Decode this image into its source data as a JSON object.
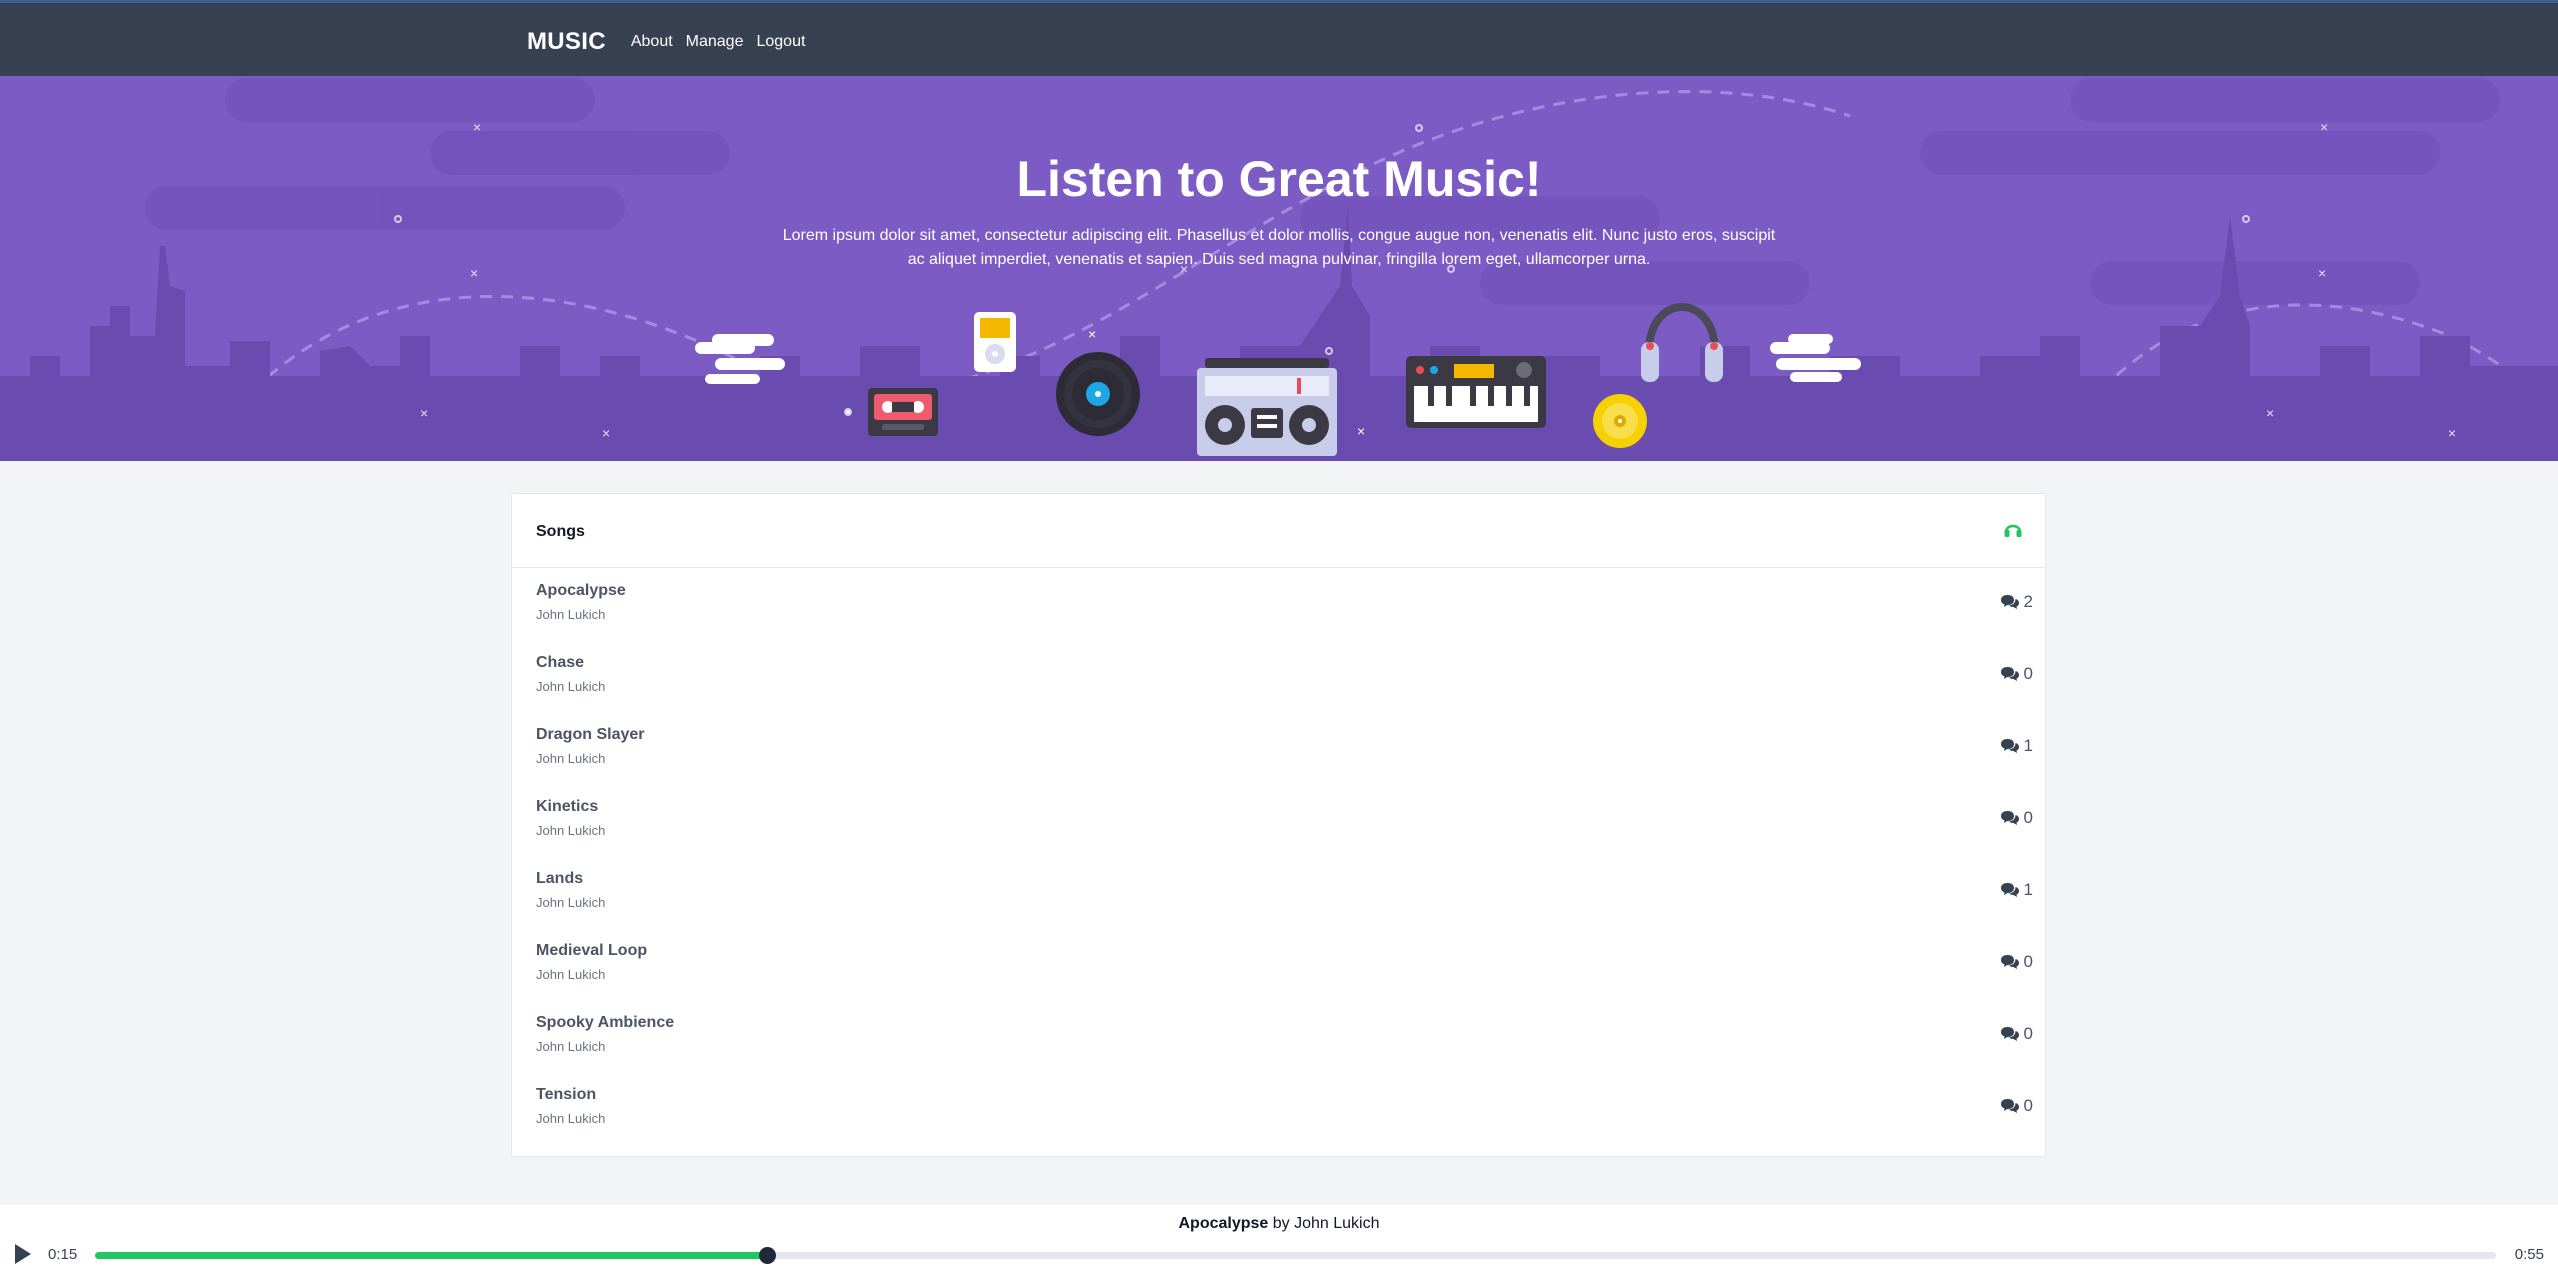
{
  "nav": {
    "brand": "MUSIC",
    "links": [
      "About",
      "Manage",
      "Logout"
    ]
  },
  "hero": {
    "title": "Listen to Great Music!",
    "text": "Lorem ipsum dolor sit amet, consectetur adipiscing elit. Phasellus et dolor mollis, congue augue non, venenatis elit. Nunc justo eros, suscipit ac aliquet imperdiet, venenatis et sapien. Duis sed magna pulvinar, fringilla lorem eget, ullamcorper urna."
  },
  "songs": {
    "title": "Songs",
    "header_icon": "headphones-icon",
    "header_icon_color": "#22c55e",
    "items": [
      {
        "title": "Apocalypse",
        "artist": "John Lukich",
        "comments": "2"
      },
      {
        "title": "Chase",
        "artist": "John Lukich",
        "comments": "0"
      },
      {
        "title": "Dragon Slayer",
        "artist": "John Lukich",
        "comments": "1"
      },
      {
        "title": "Kinetics",
        "artist": "John Lukich",
        "comments": "0"
      },
      {
        "title": "Lands",
        "artist": "John Lukich",
        "comments": "1"
      },
      {
        "title": "Medieval Loop",
        "artist": "John Lukich",
        "comments": "0"
      },
      {
        "title": "Spooky Ambience",
        "artist": "John Lukich",
        "comments": "0"
      },
      {
        "title": "Tension",
        "artist": "John Lukich",
        "comments": "0"
      }
    ]
  },
  "player": {
    "song_title": "Apocalypse",
    "by": "by",
    "artist": "John Lukich",
    "current_time": "0:15",
    "duration": "0:55",
    "progress": 0.28,
    "progress_color": "#22c55e"
  },
  "colors": {
    "header_bg": "#374151",
    "hero_bg": "#7c5cc4",
    "accent": "#22c55e"
  }
}
